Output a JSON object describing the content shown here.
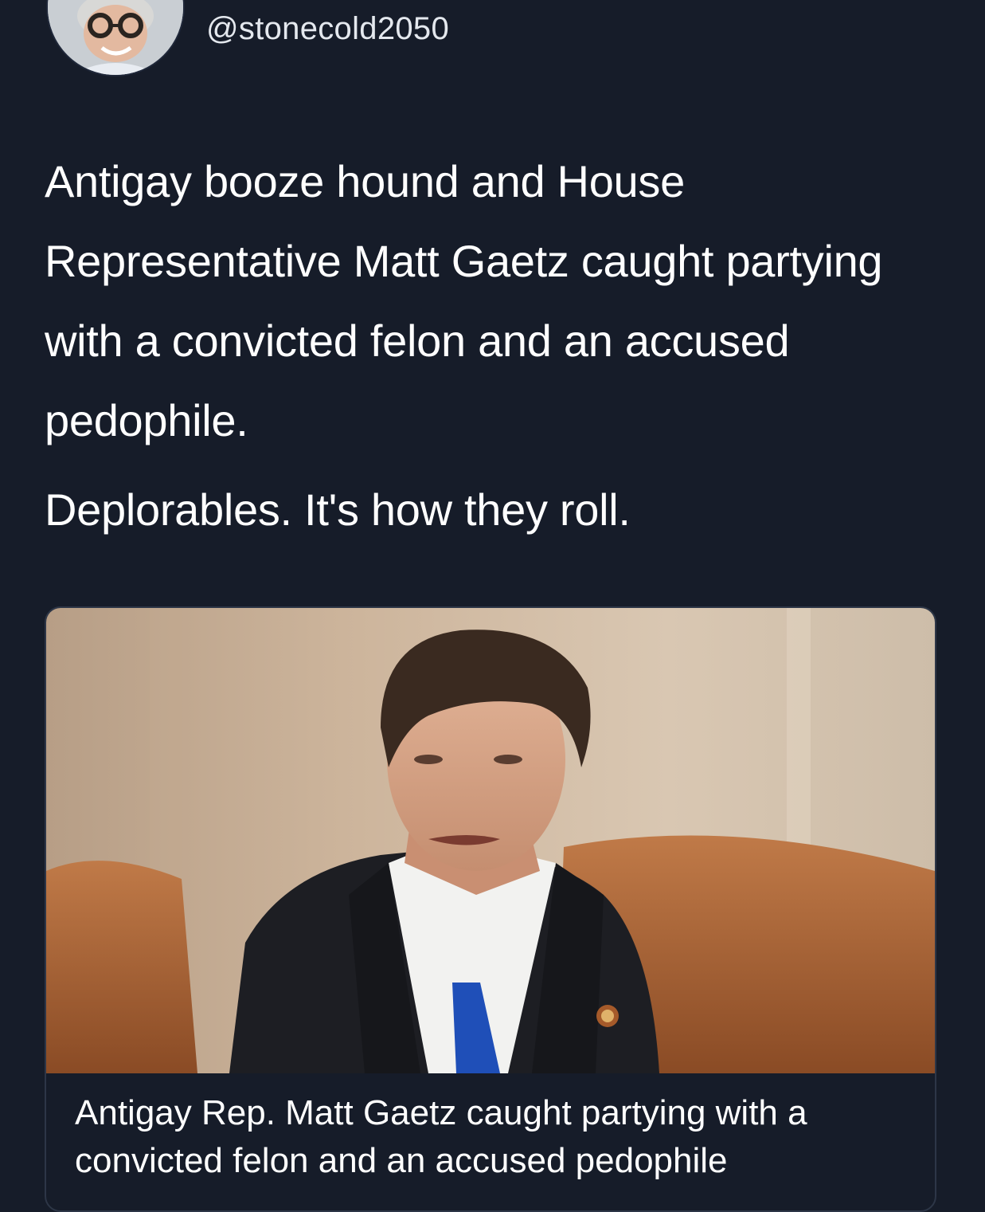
{
  "tweet": {
    "handle": "@stonecold2050",
    "paragraphs": [
      "Antigay booze hound and House Representative Matt Gaetz caught partying with a convicted felon and an accused pedophile.",
      "Deplorables. It's how they roll."
    ]
  },
  "link_card": {
    "title": "Antigay Rep. Matt Gaetz caught partying with a convicted felon and an accused pedophile"
  },
  "colors": {
    "background": "#161c29",
    "text": "#ffffff",
    "handle": "#e4e8ee",
    "card_border": "#2d3647"
  }
}
